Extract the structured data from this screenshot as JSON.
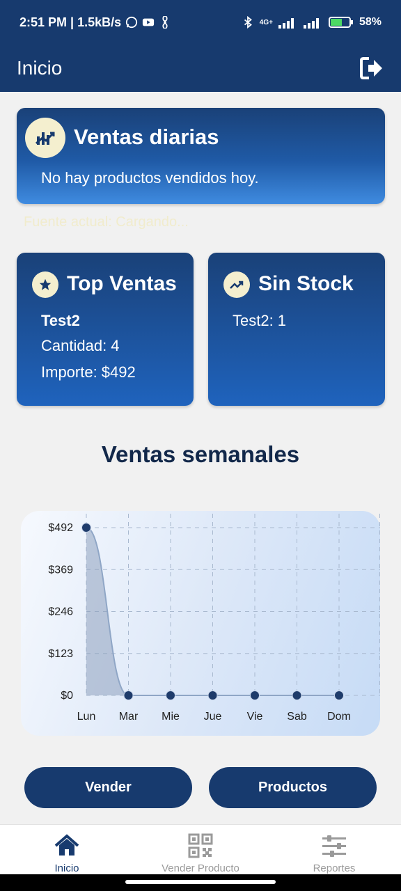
{
  "status_bar": {
    "time_speed": "2:51 PM | 1.5kB/s",
    "network": "4G+",
    "battery": "58%"
  },
  "app_bar": {
    "title": "Inicio"
  },
  "daily_card": {
    "title": "Ventas diarias",
    "message": "No hay productos vendidos hoy."
  },
  "faint_text": "Fuente actual: Cargando...",
  "top_card": {
    "title": "Top Ventas",
    "product": "Test2",
    "quantity": "Cantidad: 4",
    "amount": "Importe: $492"
  },
  "stock_card": {
    "title": "Sin Stock",
    "item": "Test2: 1"
  },
  "weekly": {
    "title": "Ventas semanales"
  },
  "chart_data": {
    "type": "area",
    "categories": [
      "Lun",
      "Mar",
      "Mie",
      "Jue",
      "Vie",
      "Sab",
      "Dom"
    ],
    "values": [
      492,
      0,
      0,
      0,
      0,
      0,
      0
    ],
    "y_ticks": [
      "$0",
      "$123",
      "$246",
      "$369",
      "$492"
    ],
    "ylim": [
      0,
      492
    ],
    "grid": true,
    "colors": {
      "line": "#8fa6c6",
      "fill": "#8ea0bd",
      "point": "#1f3c6b"
    }
  },
  "buttons": {
    "vender": "Vender",
    "productos": "Productos"
  },
  "nav": [
    {
      "label": "Inicio",
      "icon": "home-icon",
      "active": true
    },
    {
      "label": "Vender Producto",
      "icon": "qr-code-icon",
      "active": false
    },
    {
      "label": "Reportes",
      "icon": "sliders-icon",
      "active": false
    }
  ]
}
